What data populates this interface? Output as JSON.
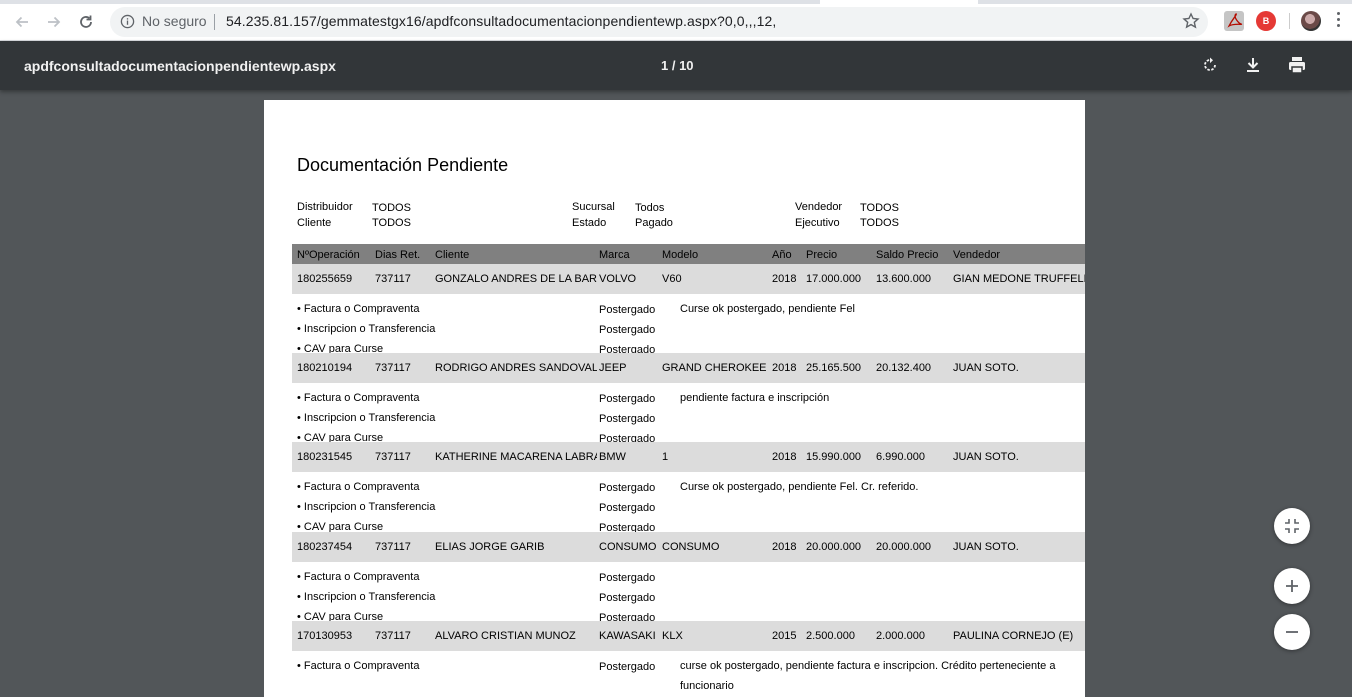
{
  "browser": {
    "security_label": "No seguro",
    "url": "54.235.81.157/gemmatestgx16/apdfconsultadocumentacionpendientewp.aspx?0,0,,,12,"
  },
  "viewer": {
    "file_title": "apdfconsultadocumentacionpendientewp.aspx",
    "page_indicator": "1 / 10"
  },
  "document": {
    "title": "Documentación Pendiente",
    "filters": {
      "distribuidor_label": "Distribuidor",
      "distribuidor_value": "TODOS",
      "cliente_label": "Cliente",
      "cliente_value": "TODOS",
      "sucursal_label": "Sucursal",
      "sucursal_value": "Todos",
      "estado_label": "Estado",
      "estado_value": "Pagado",
      "vendedor_label": "Vendedor",
      "vendedor_value": "TODOS",
      "ejecutivo_label": "Ejecutivo",
      "ejecutivo_value": "TODOS"
    },
    "columns": [
      "NºOperación",
      "Dias Ret.",
      "Cliente",
      "Marca",
      "Modelo",
      "Año",
      "Precio",
      "Saldo Precio",
      "Vendedor"
    ],
    "records": [
      {
        "operacion": "180255659",
        "dias": "737117",
        "cliente": "GONZALO ANDRES DE LA BARRA",
        "marca": "VOLVO",
        "modelo": "V60",
        "anio": "2018",
        "precio": "17.000.000",
        "saldo": "13.600.000",
        "vendedor": "GIAN MEDONE TRUFFELLO",
        "observacion": [
          "Curse ok postergado, pendiente Fel"
        ],
        "docs": [
          {
            "name": "• Factura o Compraventa",
            "status": "Postergado"
          },
          {
            "name": "• Inscripcion o Transferencia",
            "status": "Postergado"
          },
          {
            "name": "• CAV para Curse",
            "status": "Postergado"
          }
        ]
      },
      {
        "operacion": "180210194",
        "dias": "737117",
        "cliente": "RODRIGO ANDRES SANDOVAL",
        "marca": "JEEP",
        "modelo": "GRAND CHEROKEE",
        "anio": "2018",
        "precio": "25.165.500",
        "saldo": "20.132.400",
        "vendedor": "JUAN SOTO.",
        "observacion": [
          "pendiente factura e inscripción"
        ],
        "docs": [
          {
            "name": "• Factura o Compraventa",
            "status": "Postergado"
          },
          {
            "name": "• Inscripcion o Transferencia",
            "status": "Postergado"
          },
          {
            "name": "• CAV para Curse",
            "status": "Postergado"
          }
        ]
      },
      {
        "operacion": "180231545",
        "dias": "737117",
        "cliente": "KATHERINE MACARENA LABRA",
        "marca": "BMW",
        "modelo": "1",
        "anio": "2018",
        "precio": "15.990.000",
        "saldo": "6.990.000",
        "vendedor": "JUAN SOTO.",
        "observacion": [
          "Curse ok postergado, pendiente Fel. Cr. referido."
        ],
        "docs": [
          {
            "name": "• Factura o Compraventa",
            "status": "Postergado"
          },
          {
            "name": "• Inscripcion o Transferencia",
            "status": "Postergado"
          },
          {
            "name": "• CAV para Curse",
            "status": "Postergado"
          }
        ]
      },
      {
        "operacion": "180237454",
        "dias": "737117",
        "cliente": "ELIAS JORGE GARIB",
        "marca": "CONSUMO",
        "modelo": "CONSUMO",
        "anio": "2018",
        "precio": "20.000.000",
        "saldo": "20.000.000",
        "vendedor": "JUAN SOTO.",
        "observacion": [],
        "docs": [
          {
            "name": "• Factura o Compraventa",
            "status": "Postergado"
          },
          {
            "name": "• Inscripcion o Transferencia",
            "status": "Postergado"
          },
          {
            "name": "• CAV para Curse",
            "status": "Postergado"
          }
        ]
      },
      {
        "operacion": "170130953",
        "dias": "737117",
        "cliente": "ALVARO CRISTIAN MUNOZ",
        "marca": "KAWASAKI",
        "modelo": "KLX",
        "anio": "2015",
        "precio": "2.500.000",
        "saldo": "2.000.000",
        "vendedor": "PAULINA CORNEJO (E)",
        "observacion": [
          "curse ok postergado, pendiente factura e inscripcion. Crédito perteneciente a",
          "funcionario"
        ],
        "docs": [
          {
            "name": "• Factura o Compraventa",
            "status": "Postergado"
          }
        ]
      }
    ]
  }
}
